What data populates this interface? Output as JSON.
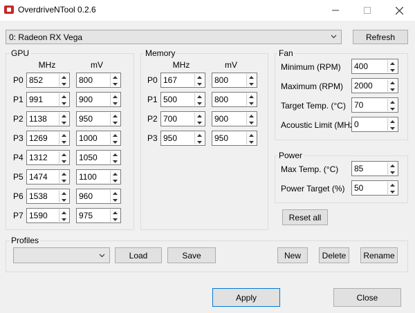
{
  "window": {
    "title": "OverdriveNTool 0.2.6"
  },
  "device": {
    "selected": "0: Radeon RX Vega",
    "refresh_label": "Refresh"
  },
  "gpu": {
    "title": "GPU",
    "col_mhz": "MHz",
    "col_mv": "mV",
    "rows": [
      {
        "label": "P0",
        "mhz": "852",
        "mv": "800"
      },
      {
        "label": "P1",
        "mhz": "991",
        "mv": "900"
      },
      {
        "label": "P2",
        "mhz": "1138",
        "mv": "950"
      },
      {
        "label": "P3",
        "mhz": "1269",
        "mv": "1000"
      },
      {
        "label": "P4",
        "mhz": "1312",
        "mv": "1050"
      },
      {
        "label": "P5",
        "mhz": "1474",
        "mv": "1100"
      },
      {
        "label": "P6",
        "mhz": "1538",
        "mv": "960"
      },
      {
        "label": "P7",
        "mhz": "1590",
        "mv": "975"
      }
    ]
  },
  "memory": {
    "title": "Memory",
    "col_mhz": "MHz",
    "col_mv": "mV",
    "rows": [
      {
        "label": "P0",
        "mhz": "167",
        "mv": "800"
      },
      {
        "label": "P1",
        "mhz": "500",
        "mv": "800"
      },
      {
        "label": "P2",
        "mhz": "700",
        "mv": "900"
      },
      {
        "label": "P3",
        "mhz": "950",
        "mv": "950"
      }
    ]
  },
  "fan": {
    "title": "Fan",
    "fields": [
      {
        "label": "Minimum (RPM)",
        "value": "400"
      },
      {
        "label": "Maximum (RPM)",
        "value": "2000"
      },
      {
        "label": "Target Temp. (°C)",
        "value": "70"
      },
      {
        "label": "Acoustic Limit (MHz)",
        "value": "0"
      }
    ]
  },
  "power": {
    "title": "Power",
    "fields": [
      {
        "label": "Max Temp. (°C)",
        "value": "85"
      },
      {
        "label": "Power Target (%)",
        "value": "50"
      }
    ]
  },
  "reset_all_label": "Reset all",
  "profiles": {
    "title": "Profiles",
    "selected": "",
    "load_label": "Load",
    "save_label": "Save",
    "new_label": "New",
    "delete_label": "Delete",
    "rename_label": "Rename"
  },
  "footer": {
    "apply_label": "Apply",
    "close_label": "Close"
  }
}
